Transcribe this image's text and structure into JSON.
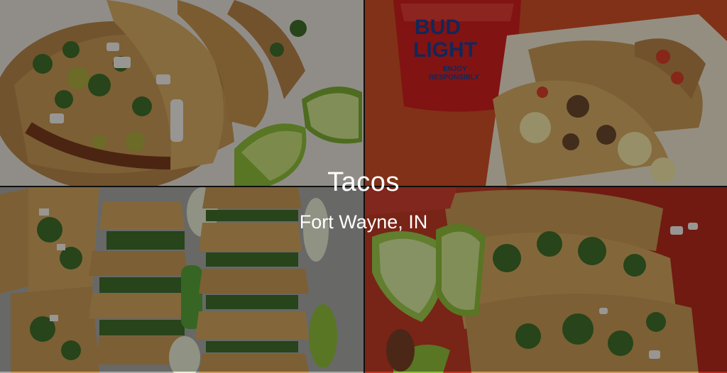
{
  "title": "Tacos",
  "location": "Fort Wayne, IN",
  "photos": [
    {
      "subject": "street tacos with onion, cilantro and lime"
    },
    {
      "subject": "tacos on paper tray with cup"
    },
    {
      "subject": "tray of many street tacos with lime"
    },
    {
      "subject": "tacos with cilantro and lime wedges on red plate"
    }
  ],
  "cup_logo": {
    "line1": "BUD",
    "line2": "LIGHT",
    "line3": "ENJOY",
    "line4": "RESPONSIBLY"
  },
  "colors": {
    "tortilla": "#c99a55",
    "cilantro": "#3f6e2a",
    "lime": "#8fbf3a",
    "red_tray": "#c23a26",
    "cup": "#d11f1f"
  }
}
